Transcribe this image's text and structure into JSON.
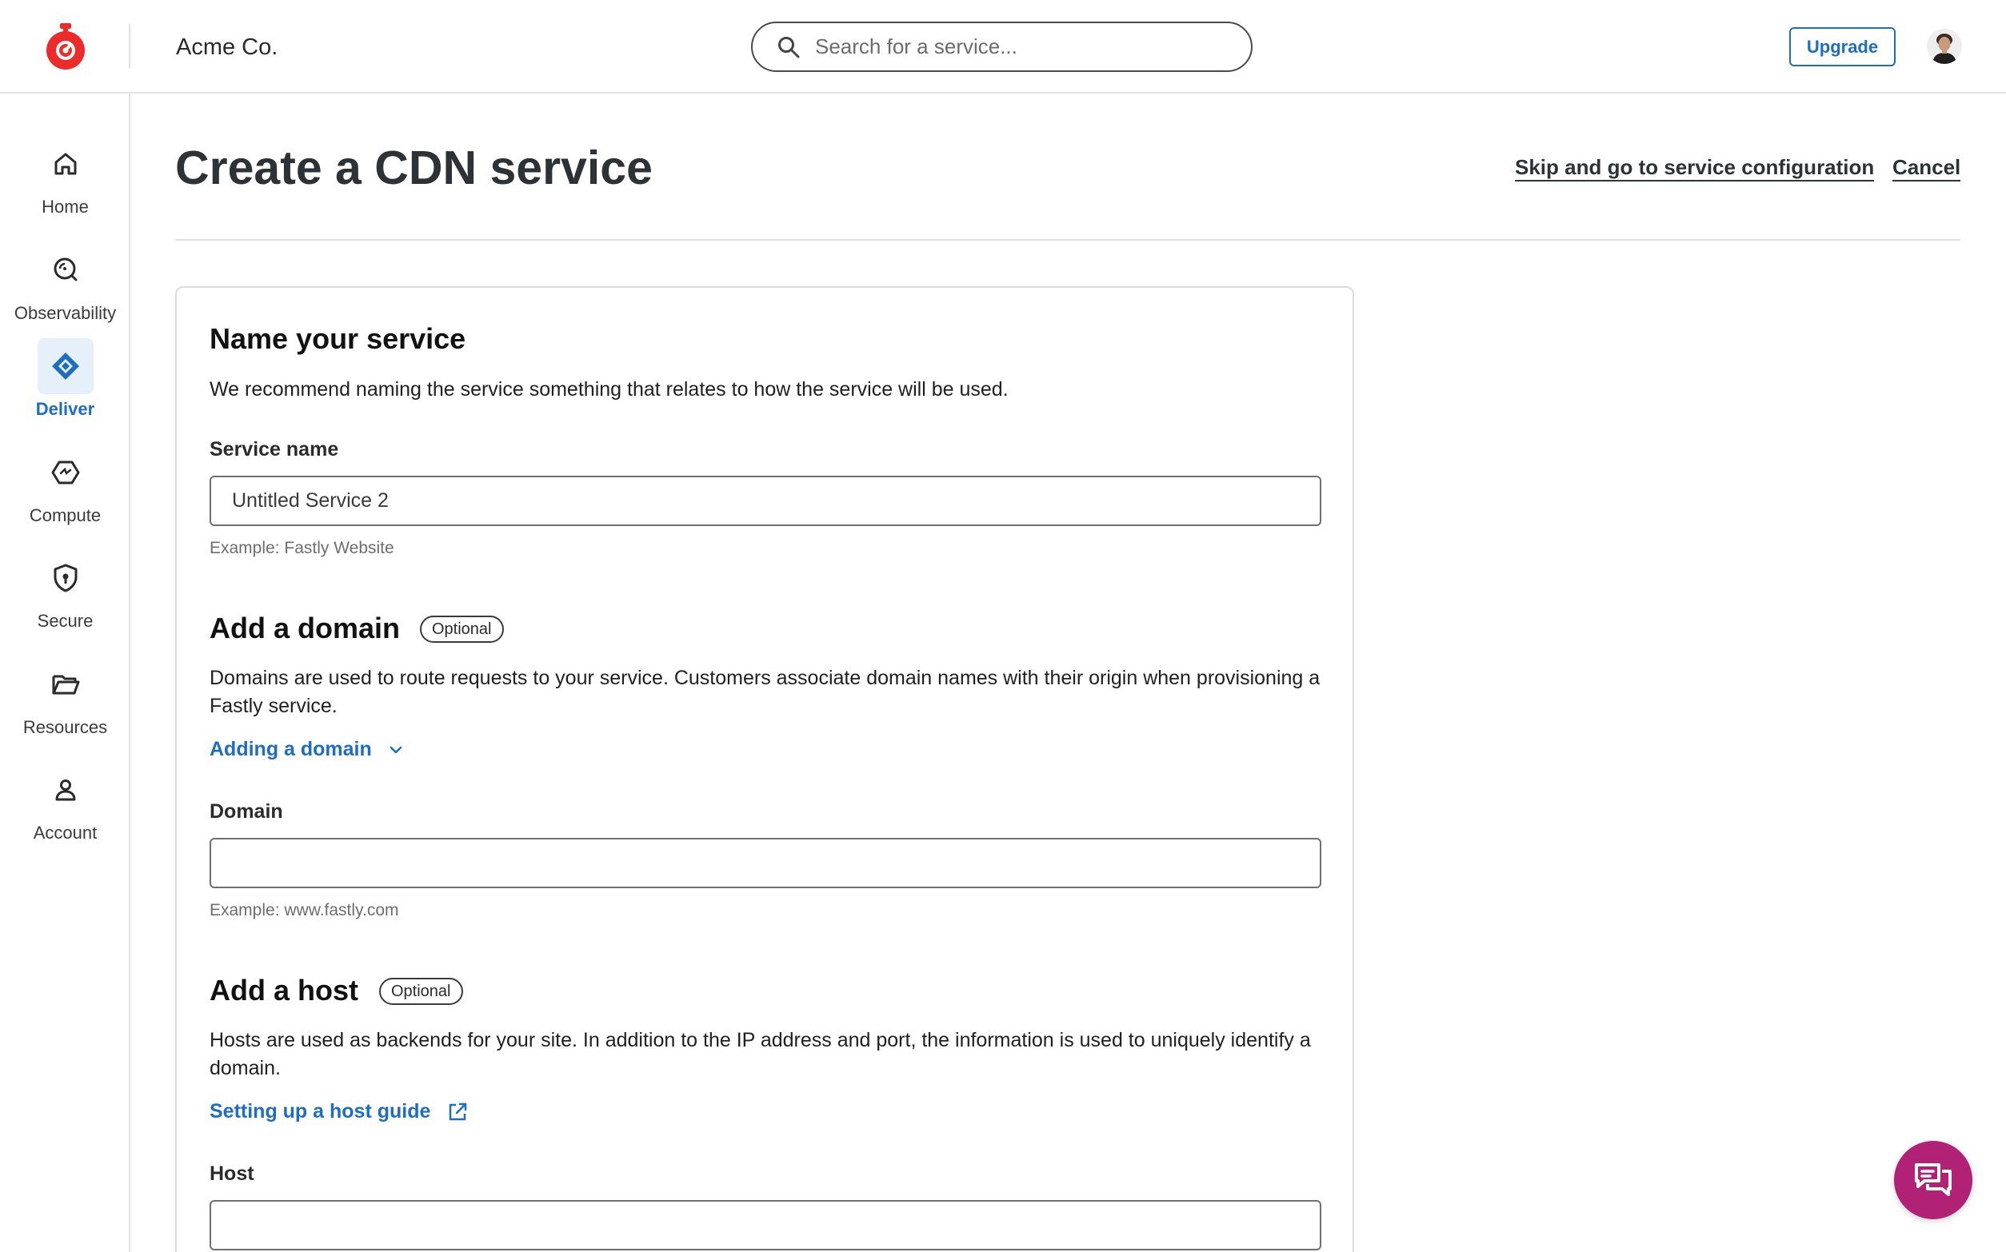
{
  "header": {
    "org_name": "Acme Co.",
    "search_placeholder": "Search for a service...",
    "upgrade_label": "Upgrade"
  },
  "sidebar": {
    "items": [
      {
        "label": "Home",
        "icon": "home-icon",
        "active": false
      },
      {
        "label": "Observability",
        "icon": "observability-icon",
        "active": false
      },
      {
        "label": "Deliver",
        "icon": "deliver-icon",
        "active": true
      },
      {
        "label": "Compute",
        "icon": "compute-icon",
        "active": false
      },
      {
        "label": "Secure",
        "icon": "shield-icon",
        "active": false
      },
      {
        "label": "Resources",
        "icon": "folder-icon",
        "active": false
      },
      {
        "label": "Account",
        "icon": "user-icon",
        "active": false
      }
    ]
  },
  "page": {
    "title": "Create a CDN service",
    "skip_link": "Skip and go to service configuration",
    "cancel_link": "Cancel"
  },
  "form": {
    "name_section": {
      "title": "Name your service",
      "description": "We recommend naming the service something that relates to how the service will be used.",
      "field_label": "Service name",
      "value": "Untitled Service 2",
      "hint": "Example: Fastly Website"
    },
    "domain_section": {
      "title": "Add a domain",
      "badge": "Optional",
      "description": "Domains are used to route requests to your service. Customers associate domain names with their origin when provisioning a Fastly service.",
      "link": "Adding a domain",
      "field_label": "Domain",
      "value": "",
      "hint": "Example: www.fastly.com"
    },
    "host_section": {
      "title": "Add a host",
      "badge": "Optional",
      "description": "Hosts are used as backends for your site. In addition to the IP address and port, the information is used to uniquely identify a domain.",
      "link": "Setting up a host guide",
      "field_label": "Host",
      "value": ""
    }
  },
  "colors": {
    "brand_red": "#ee2b2b",
    "accent_blue": "#1d6dc2",
    "chat_magenta": "#b12176"
  }
}
